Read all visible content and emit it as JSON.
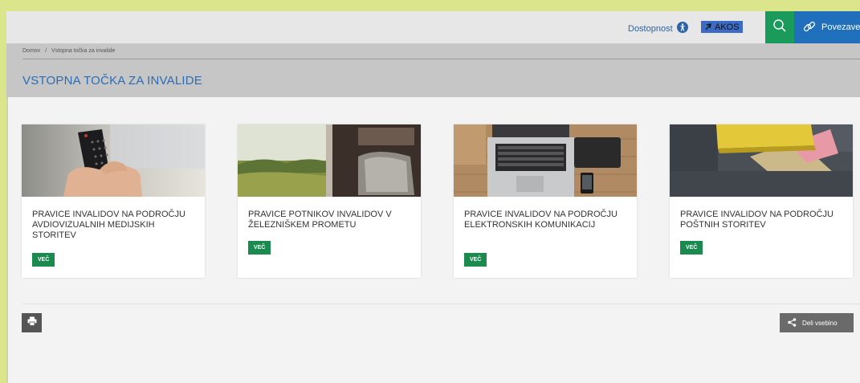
{
  "topbar": {
    "accessibility_label": "Dostopnost",
    "akos_logo": "AKOS",
    "links_label": "Povezave",
    "icons": {
      "accessibility": "accessibility-icon",
      "search": "search-icon",
      "links": "link-icon"
    }
  },
  "breadcrumb": {
    "home": "Domov",
    "separator": "/",
    "current": "Vstopna točka za invalide"
  },
  "page": {
    "title": "VSTOPNA TOČKA ZA INVALIDE"
  },
  "cards": [
    {
      "title": "PRAVICE INVALIDOV NA PODROČJU AVDIOVIZUALNIH MEDIJSKIH STORITEV",
      "button": "VEČ",
      "image": "tv-remote-photo"
    },
    {
      "title": "PRAVICE POTNIKOV INVALIDOV V ŽELEZNIŠKEM PROMETU",
      "button": "VEČ",
      "image": "train-window-photo"
    },
    {
      "title": "PRAVICE INVALIDOV NA PODROČJU ELEKTRONSKIH KOMUNIKACIJ",
      "button": "VEČ",
      "image": "laptop-desk-photo"
    },
    {
      "title": "PRAVICE INVALIDOV NA PODROČJU POŠTNIH STORITEV",
      "button": "VEČ",
      "image": "mailbox-envelopes-photo"
    }
  ],
  "footer": {
    "share_label": "Deli vsebino",
    "icons": {
      "print": "print-icon",
      "share": "share-icon"
    }
  },
  "colors": {
    "accent_green": "#1a8a4e",
    "search_green": "#1a9a5b",
    "link_blue": "#1f6fbd",
    "title_blue": "#2b6cb5",
    "outer_frame": "#dbe68c"
  }
}
